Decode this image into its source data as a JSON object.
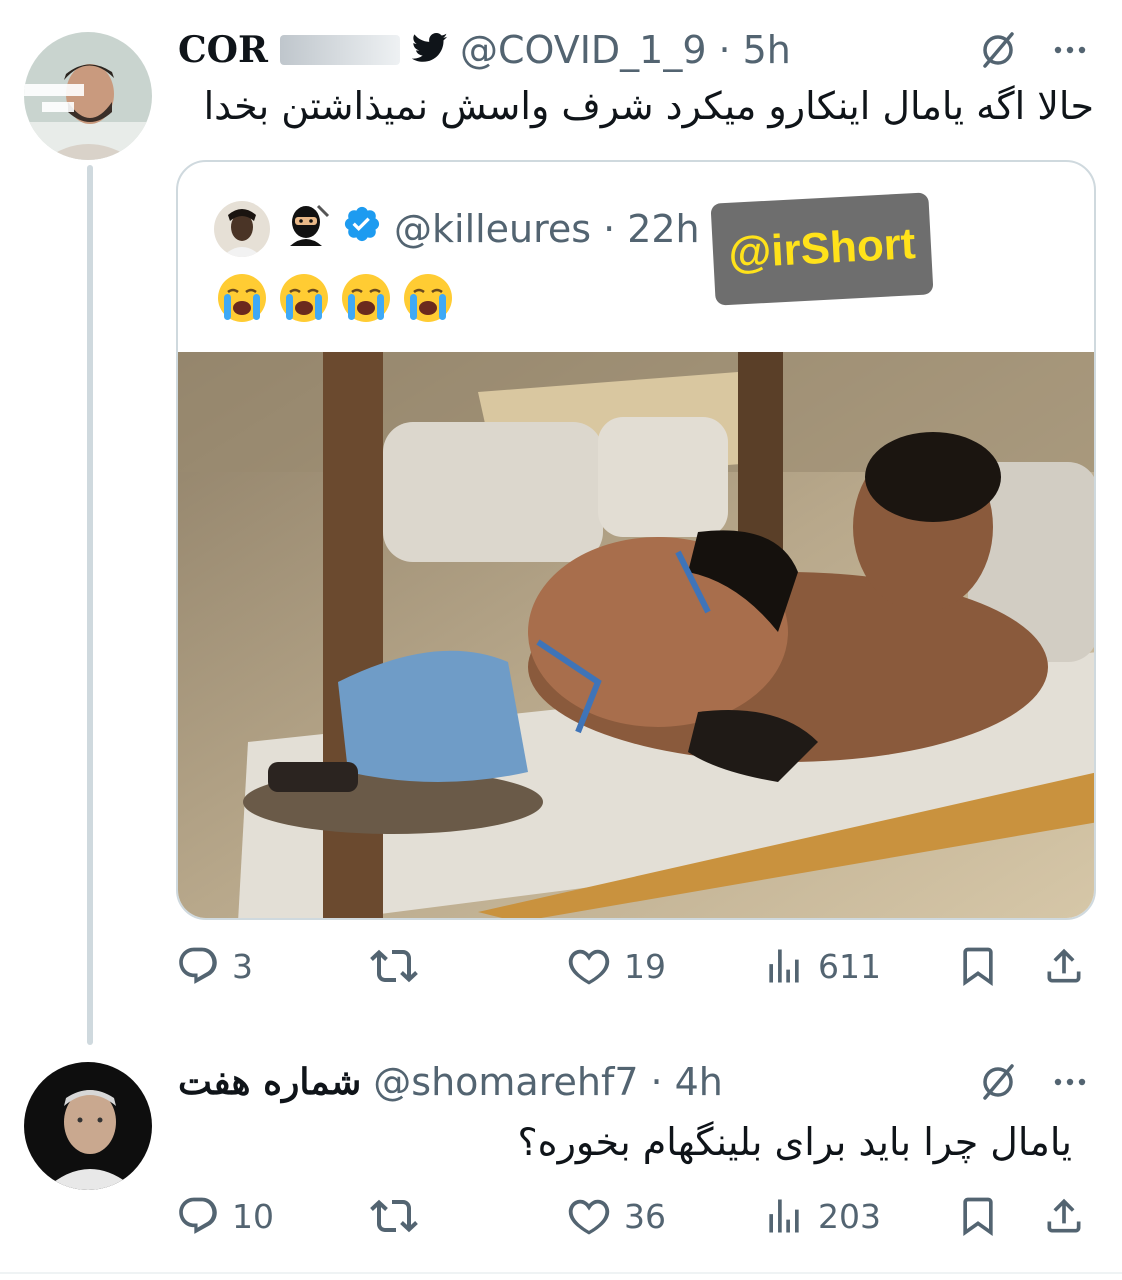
{
  "tweet1": {
    "display_name": "COR",
    "handle": "@COVID_1_9",
    "time": "5h",
    "text": "حالا اگه یامال اینکارو میکرد شرف واسش نمیذاشتن بخدا",
    "quote": {
      "handle": "@killeures",
      "time": "22h",
      "emoji_text": "😭😭😭😭"
    },
    "watermark": "@irShort",
    "stats": {
      "replies": "3",
      "retweets": "",
      "likes": "19",
      "views": "611"
    }
  },
  "tweet2": {
    "display_name": "شماره هفت",
    "handle": "@shomarehf7",
    "time": "4h",
    "text": "یامال چرا باید برای بلینگهام بخوره؟",
    "stats": {
      "replies": "10",
      "retweets": "",
      "likes": "36",
      "views": "203"
    }
  },
  "icons": {
    "verified": "verified-badge-icon",
    "twitter": "twitter-bird-icon",
    "grok": "grok-icon",
    "more": "more-icon",
    "reply": "reply-icon",
    "retweet": "retweet-icon",
    "like": "heart-icon",
    "views": "views-icon",
    "bookmark": "bookmark-icon",
    "share": "share-icon"
  },
  "colors": {
    "text": "#0f1419",
    "secondary": "#536471",
    "border": "#cfd9de",
    "verified": "#1d9bf0",
    "watermark_bg": "#6e6e6e",
    "watermark_text": "#ffe21a"
  }
}
